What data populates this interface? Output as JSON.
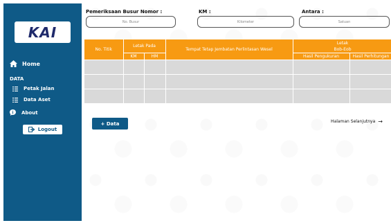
{
  "sidebar": {
    "logo_text": "KAI",
    "home_label": "Home",
    "section_label": "DATA",
    "items": [
      {
        "label": "Petak Jalan"
      },
      {
        "label": "Data Aset"
      }
    ],
    "about_label": "About",
    "logout_label": "Logout"
  },
  "filters": {
    "busur_label": "Pemeriksaan Busur Nomor :",
    "busur_placeholder": "No. Busur",
    "km_label": "KM :",
    "km_placeholder": "Kilometer",
    "antara_label": "Antara :",
    "antara_placeholder": "Satuan"
  },
  "table": {
    "col_no_titik": "No. Titik",
    "col_letak_pada": "Letak Pada",
    "col_km": "KM",
    "col_hm": "HM",
    "col_tempat": "Tempat Tetap Jembatan Perlintasan Wesel",
    "col_letak": "Letak",
    "col_bob_eob": "Bob-Eob",
    "col_hasil_pengukuran": "Hasil Pengukuran",
    "col_hasil_perhitungan": "Hasil Perhitungan"
  },
  "actions": {
    "add_label": "+ Data",
    "next_label": "Halaman Selanjutnya",
    "next_arrow": "→"
  },
  "colors": {
    "sidebar": "#0f5a87",
    "header": "#f79a12",
    "cell": "#d9d9d9"
  }
}
